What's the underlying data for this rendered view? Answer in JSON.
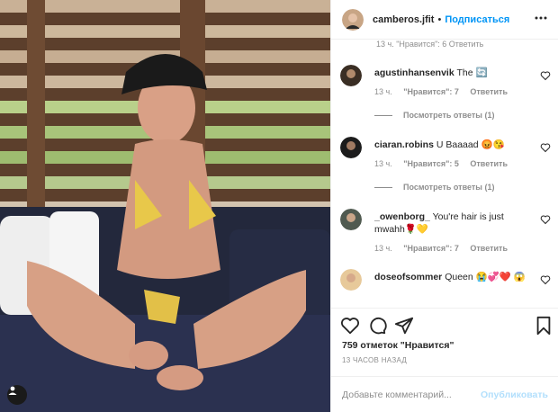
{
  "post": {
    "username": "camberos.jfit",
    "separator": "•",
    "follow_label": "Подписаться",
    "likes_text": "759 отметок \"Нравится\"",
    "timestamp": "13 ЧАСОВ НАЗАД"
  },
  "partial_meta": "13 ч.   \"Нравится\": 6   Ответить",
  "comments": [
    {
      "username": "agustinhansenvik",
      "text": "The 🔄",
      "time": "13 ч.",
      "likes": "\"Нравится\": 7",
      "reply": "Ответить",
      "view_replies": "Посмотреть ответы (1)",
      "avatar_color": "#3a2e24"
    },
    {
      "username": "ciaran.robins",
      "text": "U Baaaad 😡😘",
      "time": "13 ч.",
      "likes": "\"Нравится\": 5",
      "reply": "Ответить",
      "view_replies": "Посмотреть ответы (1)",
      "avatar_color": "#1c1c1c"
    },
    {
      "username": "_owenborg_",
      "text": "You're hair is just mwahh🌹💛",
      "time": "13 ч.",
      "likes": "\"Нравится\": 7",
      "reply": "Ответить",
      "avatar_color": "#505a50"
    },
    {
      "username": "doseofsommer",
      "text": "Queen 😭💞❤️ 😱",
      "avatar_color": "#e7c99a"
    }
  ],
  "add_comment": {
    "placeholder": "Добавьте комментарий...",
    "publish_label": "Опубликовать"
  },
  "colors": {
    "accent": "#0095f6",
    "publish_disabled": "#b2dffc",
    "muted": "#8e8e8e"
  },
  "icons": [
    "heart-icon",
    "comment-icon",
    "share-icon",
    "bookmark-icon",
    "more-icon",
    "user-tag-icon"
  ]
}
